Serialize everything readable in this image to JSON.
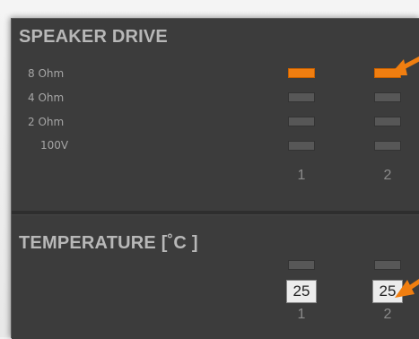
{
  "speaker_drive": {
    "title": "SPEAKER DRIVE",
    "rows": [
      {
        "label": "8 Ohm",
        "ch1_on": true,
        "ch2_on": true
      },
      {
        "label": "4 Ohm",
        "ch1_on": false,
        "ch2_on": false
      },
      {
        "label": "2 Ohm",
        "ch1_on": false,
        "ch2_on": false
      },
      {
        "label": "100V",
        "ch1_on": false,
        "ch2_on": false
      }
    ],
    "channels": [
      "1",
      "2"
    ]
  },
  "temperature": {
    "title": "TEMPERATURE [˚C ]",
    "values": [
      "25",
      "25"
    ],
    "channels": [
      "1",
      "2"
    ]
  },
  "colors": {
    "panel_bg": "#3c3c3c",
    "led_on": "#f07e10",
    "led_off": "#575757",
    "annotation_arrow": "#f07e10"
  },
  "icons": [
    "annotation-arrow-icon",
    "annotation-arrow-icon"
  ]
}
